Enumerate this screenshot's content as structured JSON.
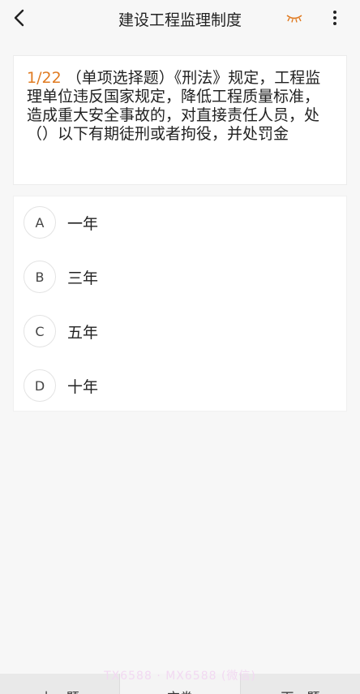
{
  "header": {
    "title": "建设工程监理制度",
    "back_icon": "chevron-left-icon",
    "eye_icon": "eye-closed-icon",
    "more_icon": "more-vertical-icon",
    "accent_color": "#e07b22"
  },
  "question": {
    "number": "1/22",
    "text": " （单项选择题）《刑法》规定，工程监理单位违反国家规定，降低工程质量标准，造成重大安全事故的，对直接责任人员，处（）以下有期徒刑或者拘役，并处罚金"
  },
  "options": [
    {
      "letter": "A",
      "text": "一年"
    },
    {
      "letter": "B",
      "text": "三年"
    },
    {
      "letter": "C",
      "text": "五年"
    },
    {
      "letter": "D",
      "text": "十年"
    }
  ],
  "watermark": "TX6588 · MX6588 (微信)",
  "bottom_bar": {
    "prev_label": "上一题",
    "middle_label": "交卷",
    "next_label": "下一题"
  }
}
